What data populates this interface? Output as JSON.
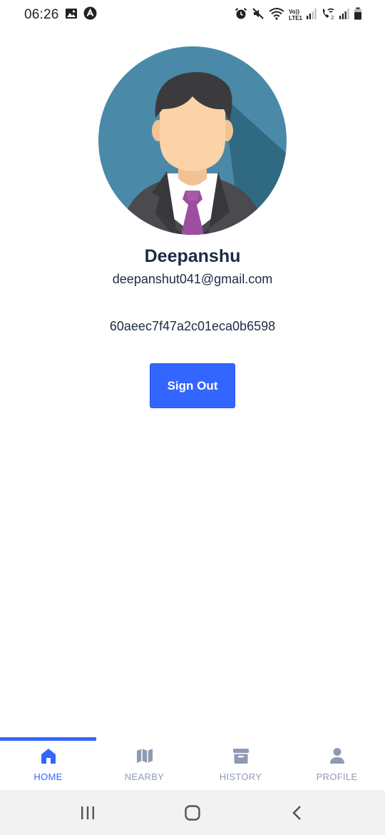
{
  "status_bar": {
    "time": "06:26",
    "left_icons": [
      "image-icon",
      "app-notification-icon"
    ],
    "right_icons": [
      "alarm-icon",
      "mute-icon",
      "wifi-icon",
      "volte-icon",
      "signal-icon",
      "wifi-call-icon",
      "signal-2-icon",
      "battery-icon"
    ],
    "volte_text": "Vo))",
    "lte_text": "LTE1"
  },
  "profile": {
    "name": "Deepanshu",
    "email": "deepanshut041@gmail.com",
    "user_id": "60aeec7f47a2c01eca0b6598"
  },
  "actions": {
    "sign_out_label": "Sign Out"
  },
  "tabs": [
    {
      "label": "HOME",
      "icon": "home-icon",
      "active": true
    },
    {
      "label": "NEARBY",
      "icon": "map-icon",
      "active": false
    },
    {
      "label": "HISTORY",
      "icon": "archive-icon",
      "active": false
    },
    {
      "label": "PROFILE",
      "icon": "person-icon",
      "active": false
    }
  ],
  "colors": {
    "accent": "#3366ff",
    "inactive_tab": "#8f9bb3",
    "text_dark": "#1e2a44"
  }
}
